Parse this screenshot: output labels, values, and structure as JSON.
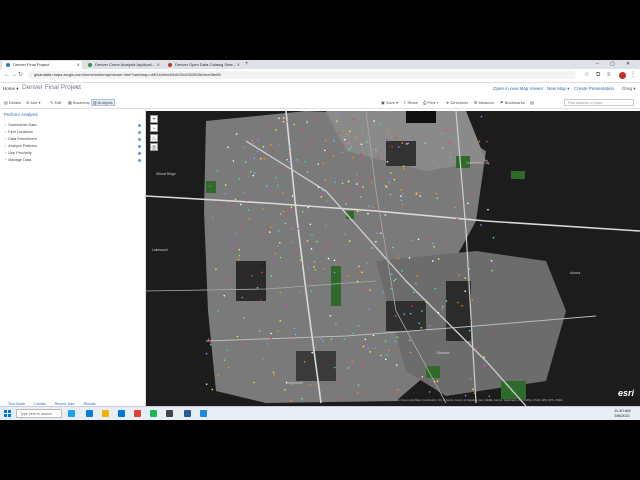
{
  "browser": {
    "tabs": [
      {
        "label": "Denver Final Project",
        "active": true
      },
      {
        "label": "Denver Crime Analysis Applicati...",
        "active": false
      },
      {
        "label": "Denver Open Data Catalog Sear...",
        "active": false
      }
    ],
    "new_tab": "+",
    "url": "gisandata.maps.arcgis.com/home/webmap/viewer.html?webmap=d9f1b2ebe00d420c9330928e0ee08e85"
  },
  "app": {
    "home_label": "Home ▾",
    "map_title": "Denver Final Project",
    "header_links": [
      "Open in new Map Viewer",
      "New Map ▾",
      "Create Presentation"
    ],
    "user": "Greg ▾"
  },
  "toolbar": {
    "details": "Details",
    "add": "Add ▾",
    "edit": "Edit",
    "basemap": "Basemap",
    "analysis": "Analysis",
    "save": "Save ▾",
    "share": "Share",
    "print": "Print ▾",
    "directions": "Directions",
    "measure": "Measure",
    "bookmarks": "Bookmarks",
    "find_placeholder": "Find address or place"
  },
  "panel": {
    "header": "Perform Analysis",
    "items": [
      "Summarize Data",
      "Find Locations",
      "Data Enrichment",
      "Analyze Patterns",
      "Use Proximity",
      "Manage Data"
    ],
    "footer_links": [
      "Tool Guide",
      "Credits",
      "Recent Jobs",
      "Results"
    ]
  },
  "map": {
    "place_labels": [
      "Wheat Ridge",
      "Lakewood",
      "Englewood",
      "Aurora",
      "Commerce City",
      "Glendale"
    ],
    "attribution": "Esri Community Maps Contributors, City of Aurora, County of Arapahoe, Esri, HERE, Garmin, SafeGraph, METI/NASA, USGS, EPA, NPS, USDA",
    "logo": "esri",
    "colors": {
      "basemap_dark": "#1c1c1c",
      "urban_gray": "#7a7a7a",
      "park_green": "#2e6b2a",
      "highway": "#d9d9d9"
    }
  },
  "taskbar": {
    "search_placeholder": "Type here to search",
    "time": "11:40 AM",
    "date": "5/6/2021"
  }
}
